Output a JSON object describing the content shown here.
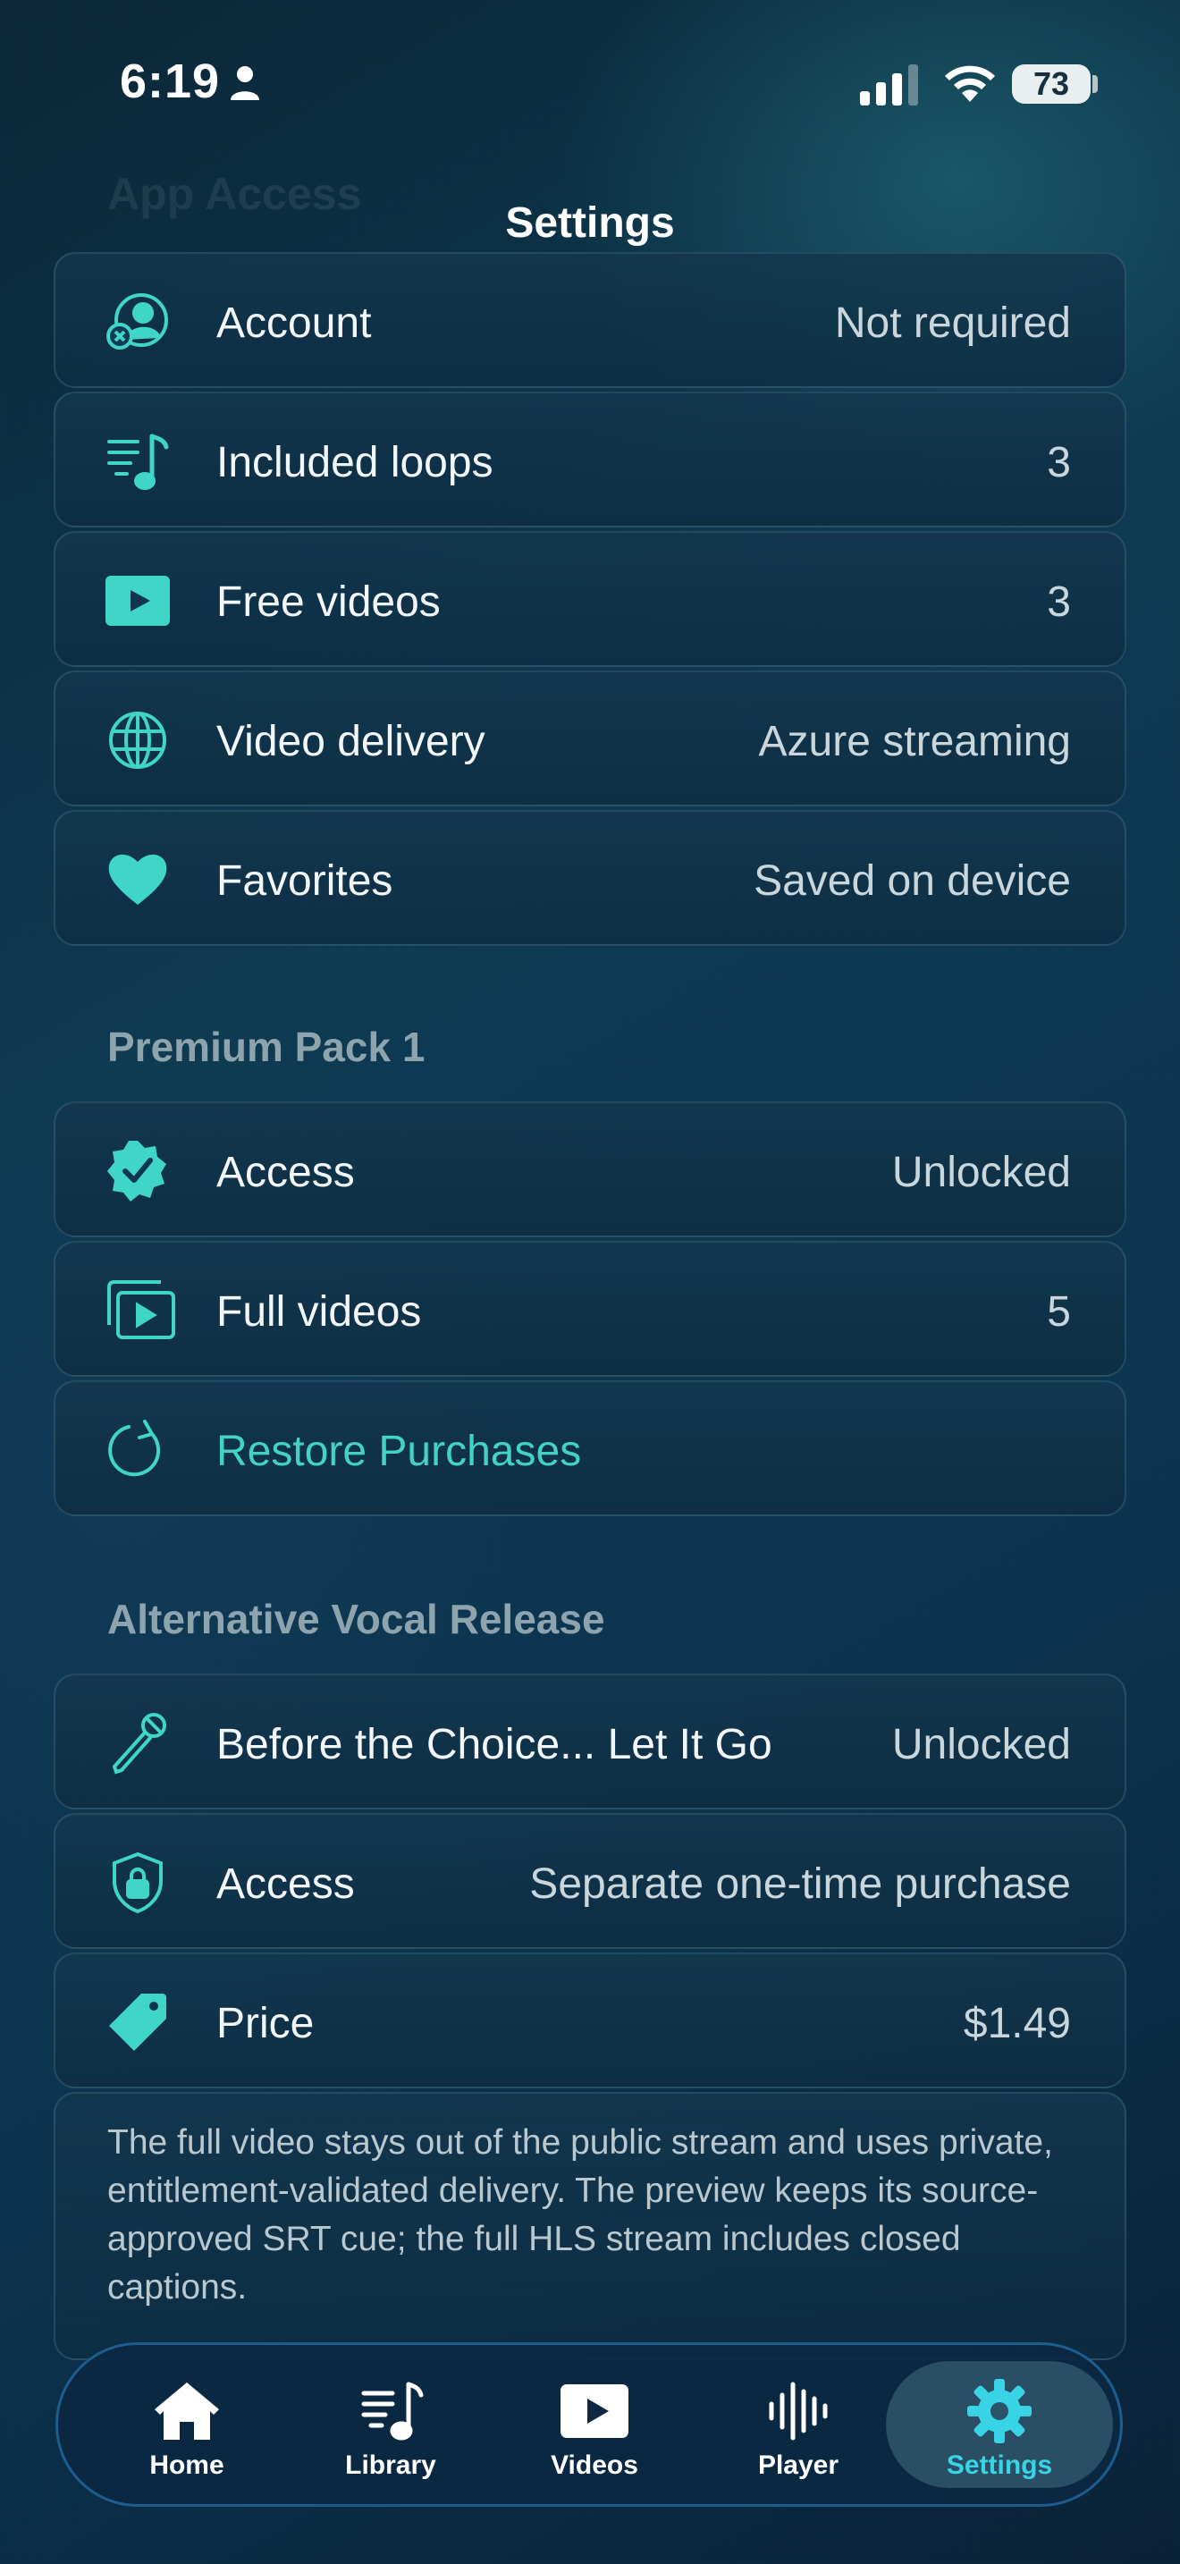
{
  "status_bar": {
    "time": "6:19",
    "battery": "73"
  },
  "ghost_header": "App Access",
  "nav": {
    "title": "Settings"
  },
  "app_access": [
    {
      "icon": "account-x-icon",
      "label": "Account",
      "value": "Not required"
    },
    {
      "icon": "music-list-icon",
      "label": "Included loops",
      "value": "3"
    },
    {
      "icon": "play-rect-icon",
      "label": "Free videos",
      "value": "3"
    },
    {
      "icon": "globe-icon",
      "label": "Video delivery",
      "value": "Azure streaming"
    },
    {
      "icon": "heart-icon",
      "label": "Favorites",
      "value": "Saved on device"
    }
  ],
  "premium": {
    "header": "Premium Pack 1",
    "rows": [
      {
        "icon": "verified-badge-icon",
        "label": "Access",
        "value": "Unlocked"
      },
      {
        "icon": "stacked-play-icon",
        "label": "Full videos",
        "value": "5"
      },
      {
        "icon": "restore-icon",
        "label": "Restore Purchases",
        "value": ""
      }
    ]
  },
  "alt_vocal": {
    "header": "Alternative Vocal Release",
    "rows": [
      {
        "icon": "microphone-icon",
        "label": "Before the Choice... Let It Go",
        "value": "Unlocked"
      },
      {
        "icon": "lock-shield-icon",
        "label": "Access",
        "value": "Separate one-time purchase"
      },
      {
        "icon": "tag-icon",
        "label": "Price",
        "value": "$1.49"
      }
    ],
    "note": "The full video stays out of the public stream and uses private, entitlement-validated delivery. The preview keeps its source-approved SRT cue; the full HLS stream includes closed captions."
  },
  "tabs": [
    {
      "icon": "home-icon",
      "label": "Home"
    },
    {
      "icon": "library-icon",
      "label": "Library"
    },
    {
      "icon": "videos-icon",
      "label": "Videos"
    },
    {
      "icon": "waveform-icon",
      "label": "Player"
    },
    {
      "icon": "gear-icon",
      "label": "Settings"
    }
  ],
  "colors": {
    "accent": "#3fd6c8",
    "active_tab": "#38d4e6"
  }
}
